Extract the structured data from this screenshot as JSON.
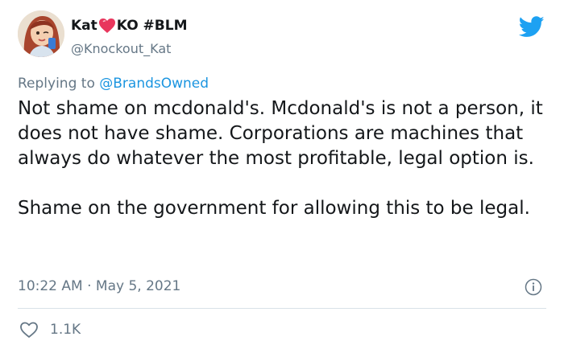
{
  "tweet": {
    "author": {
      "name_part1": "Kat",
      "name_part2": "KO #BLM",
      "handle": "@Knockout_Kat"
    },
    "replying_to": {
      "prefix": "Replying to",
      "handle": "@BrandsOwned"
    },
    "text": {
      "paragraph1": "Not shame on mcdonald's. Mcdonald's is not a person, it does not have shame. Corporations are machines that always do whatever the most profitable, legal option is.",
      "paragraph2": "Shame on the government for allowing this to be legal."
    },
    "timestamp": "10:22 AM · May 5, 2021",
    "likes": "1.1K"
  },
  "colors": {
    "text": "#14171a",
    "secondary": "#657786",
    "link": "#1b95e0",
    "twitter_blue": "#1da1f2",
    "heart_emoji": "#e8365d",
    "divider": "#d9e1e8"
  },
  "icons": {
    "brand": "twitter-bird-icon",
    "name_emoji": "heart-emoji-icon",
    "info": "info-icon",
    "like": "heart-outline-icon"
  }
}
